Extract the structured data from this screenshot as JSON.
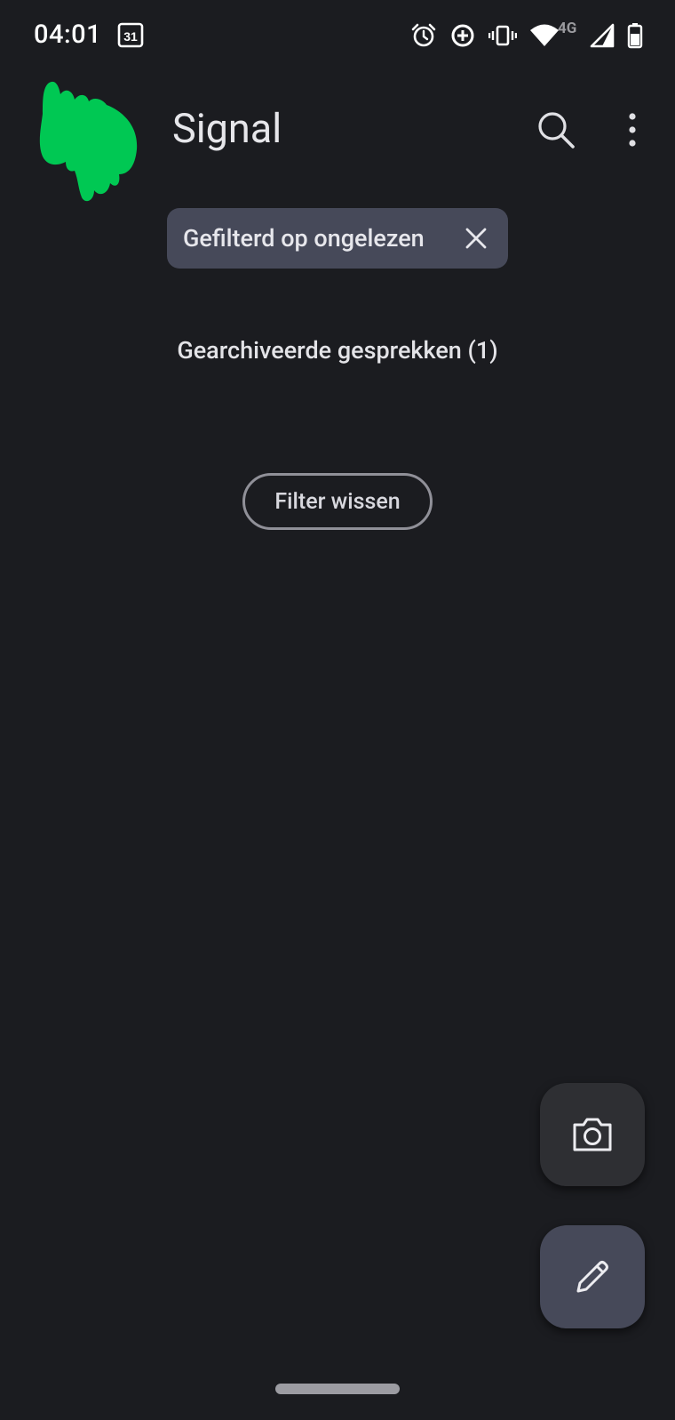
{
  "status_bar": {
    "time": "04:01",
    "calendar_day": "31",
    "network_type": "4G"
  },
  "app_bar": {
    "title": "Signal"
  },
  "filter": {
    "chip_label": "Gefilterd op ongelezen",
    "archived_label": "Gearchiveerde gesprekken (1)",
    "clear_button_label": "Filter wissen"
  },
  "colors": {
    "background": "#1b1c20",
    "chip_background": "#464959",
    "avatar_green": "#00c853",
    "camera_fab": "#2e2f33",
    "compose_fab": "#464959"
  },
  "icons": {
    "status": [
      "alarm-icon",
      "data-saver-icon",
      "vibrate-icon",
      "wifi-icon",
      "signal-icon",
      "battery-icon"
    ],
    "app_bar": [
      "search-icon",
      "more-vert-icon"
    ],
    "fabs": [
      "camera-icon",
      "pencil-icon"
    ]
  }
}
